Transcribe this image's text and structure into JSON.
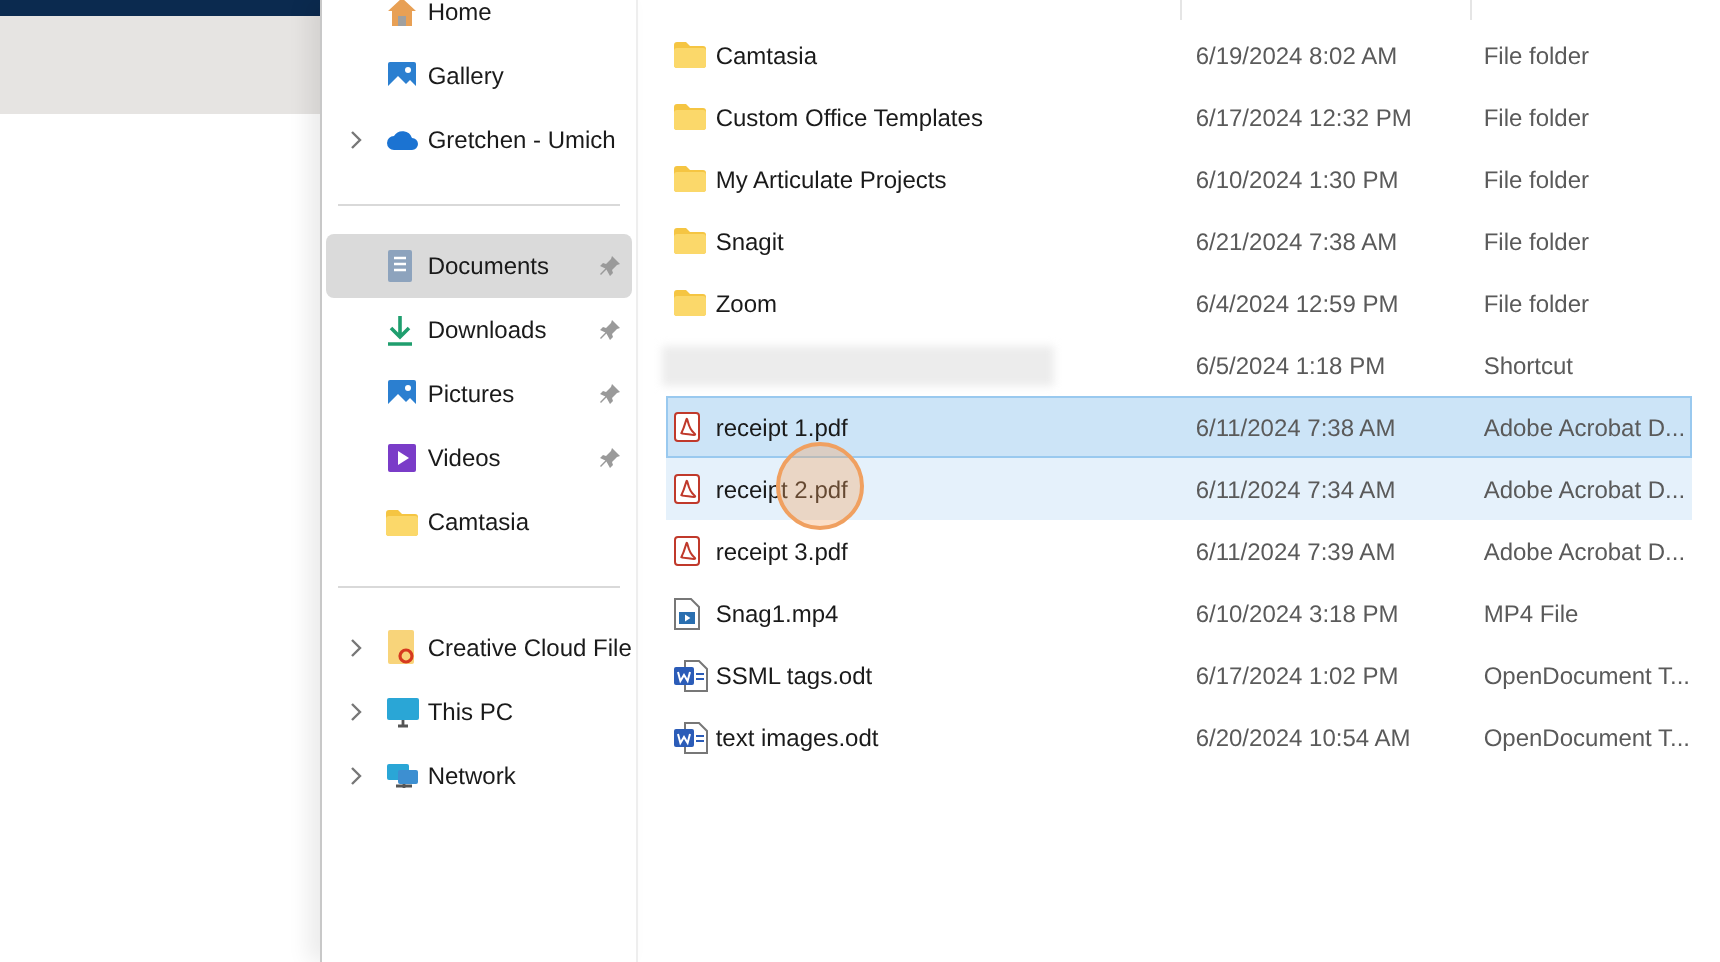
{
  "sidebar": {
    "groups": [
      {
        "items": [
          {
            "label": "Home",
            "expandable": false,
            "pinned": false,
            "selected": false
          },
          {
            "label": "Gallery",
            "expandable": false,
            "pinned": false,
            "selected": false
          },
          {
            "label": "Gretchen - Umich",
            "expandable": true,
            "pinned": false,
            "selected": false
          }
        ]
      },
      {
        "items": [
          {
            "label": "Documents",
            "expandable": false,
            "pinned": true,
            "selected": true
          },
          {
            "label": "Downloads",
            "expandable": false,
            "pinned": true,
            "selected": false
          },
          {
            "label": "Pictures",
            "expandable": false,
            "pinned": true,
            "selected": false
          },
          {
            "label": "Videos",
            "expandable": false,
            "pinned": true,
            "selected": false
          },
          {
            "label": "Camtasia",
            "expandable": false,
            "pinned": false,
            "selected": false
          }
        ]
      },
      {
        "items": [
          {
            "label": "Creative Cloud File",
            "expandable": true,
            "pinned": false,
            "selected": false
          },
          {
            "label": "This PC",
            "expandable": true,
            "pinned": false,
            "selected": false
          },
          {
            "label": "Network",
            "expandable": true,
            "pinned": false,
            "selected": false
          }
        ]
      }
    ]
  },
  "files": [
    {
      "kind": "folder",
      "name": "Camtasia",
      "date": "6/19/2024 8:02 AM",
      "type": "File folder",
      "selected": false,
      "hovered": false
    },
    {
      "kind": "folder",
      "name": "Custom Office Templates",
      "date": "6/17/2024 12:32 PM",
      "type": "File folder",
      "selected": false,
      "hovered": false
    },
    {
      "kind": "folder",
      "name": "My Articulate Projects",
      "date": "6/10/2024 1:30 PM",
      "type": "File folder",
      "selected": false,
      "hovered": false
    },
    {
      "kind": "folder",
      "name": "Snagit",
      "date": "6/21/2024 7:38 AM",
      "type": "File folder",
      "selected": false,
      "hovered": false
    },
    {
      "kind": "folder",
      "name": "Zoom",
      "date": "6/4/2024 12:59 PM",
      "type": "File folder",
      "selected": false,
      "hovered": false
    },
    {
      "kind": "blurred",
      "date": "6/5/2024 1:18 PM",
      "type": "Shortcut",
      "selected": false,
      "hovered": false
    },
    {
      "kind": "pdf",
      "name": "receipt 1.pdf",
      "date": "6/11/2024 7:38 AM",
      "type": "Adobe Acrobat D...",
      "selected": true,
      "hovered": false
    },
    {
      "kind": "pdf",
      "name": "receipt 2.pdf",
      "date": "6/11/2024 7:34 AM",
      "type": "Adobe Acrobat D...",
      "selected": false,
      "hovered": true
    },
    {
      "kind": "pdf",
      "name": "receipt 3.pdf",
      "date": "6/11/2024 7:39 AM",
      "type": "Adobe Acrobat D...",
      "selected": false,
      "hovered": false
    },
    {
      "kind": "video",
      "name": "Snag1.mp4",
      "date": "6/10/2024 3:18 PM",
      "type": "MP4 File",
      "selected": false,
      "hovered": false
    },
    {
      "kind": "document",
      "name": "SSML tags.odt",
      "date": "6/17/2024 1:02 PM",
      "type": "OpenDocument T...",
      "selected": false,
      "hovered": false
    },
    {
      "kind": "document",
      "name": "text images.odt",
      "date": "6/20/2024 10:54 AM",
      "type": "OpenDocument T...",
      "selected": false,
      "hovered": false
    }
  ]
}
